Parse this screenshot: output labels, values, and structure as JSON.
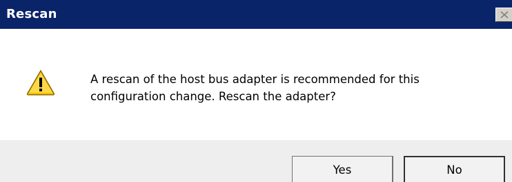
{
  "window": {
    "title": "Rescan",
    "close_icon": "close-icon"
  },
  "message": {
    "icon": "warning-icon",
    "line1": "A rescan of the host bus adapter is recommended for this",
    "line2": "configuration change. Rescan the adapter?"
  },
  "buttons": {
    "yes_label": "Yes",
    "no_label": "No"
  },
  "colors": {
    "titlebar": "#0a246a",
    "button_area": "#eeeeee",
    "warning_yellow": "#f5c400"
  }
}
